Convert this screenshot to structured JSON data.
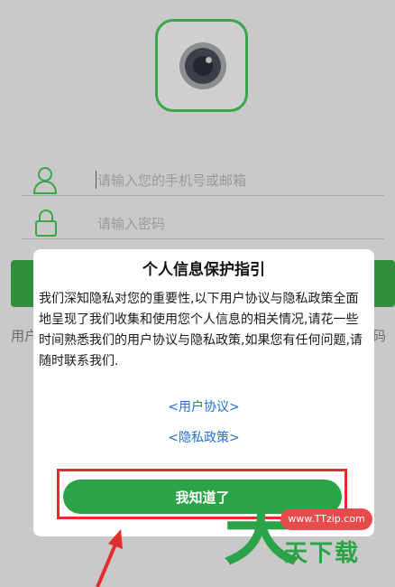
{
  "login": {
    "account_placeholder": "请输入您的手机号或邮箱",
    "password_placeholder": "请输入密码",
    "footer_left_fragment": "用户",
    "footer_right_fragment": "码"
  },
  "dialog": {
    "title": "个人信息保护指引",
    "body": "我们深知隐私对您的重要性,以下用户协议与隐私政策全面地呈现了我们收集和使用您个人信息的相关情况,请花一些时间熟悉我们的用户协议与隐私政策,如果您有任何问题,请随时联系我们.",
    "user_agreement_link": "<用户协议>",
    "privacy_policy_link": "<隐私政策>",
    "ok_button": "我知道了"
  },
  "watermark": {
    "url": "www.TTzip.com",
    "big_char": "天",
    "text": "天下载"
  },
  "colors": {
    "accent_green": "#2aa447",
    "link_blue": "#1f6fd0",
    "highlight_red": "#e32d2d"
  }
}
